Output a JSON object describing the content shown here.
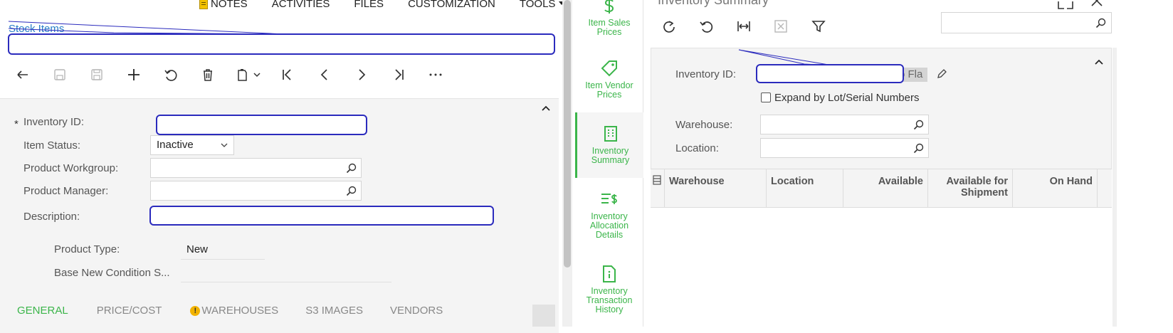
{
  "top_menu": [
    "NOTES",
    "ACTIVITIES",
    "FILES",
    "CUSTOMIZATION",
    "TOOLS"
  ],
  "breadcrumb": "Stock Items",
  "form": {
    "inventory_id_label": "Inventory ID:",
    "required_mark": "*",
    "item_status_label": "Item Status:",
    "item_status_value": "Inactive",
    "product_workgroup_label": "Product Workgroup:",
    "product_manager_label": "Product Manager:",
    "description_label": "Description:",
    "product_type_label": "Product Type:",
    "product_type_value": "New",
    "base_new_condition_label": "Base New Condition S..."
  },
  "tabs": [
    {
      "label": "GENERAL",
      "active": true
    },
    {
      "label": "PRICE/COST",
      "active": false
    },
    {
      "label": "WAREHOUSES",
      "active": false,
      "warning": true
    },
    {
      "label": "S3 IMAGES",
      "active": false
    },
    {
      "label": "VENDORS",
      "active": false
    }
  ],
  "warning_glyph": "!",
  "side_nav": [
    {
      "label_lines": [
        "Item Sales",
        "Prices"
      ],
      "icon": "dollar-icon"
    },
    {
      "label_lines": [
        "Item Vendor",
        "Prices"
      ],
      "icon": "tag-icon"
    },
    {
      "label_lines": [
        "Inventory",
        "Summary"
      ],
      "icon": "building-icon",
      "active": true
    },
    {
      "label_lines": [
        "Inventory",
        "Allocation",
        "Details"
      ],
      "icon": "list-dollar-icon"
    },
    {
      "label_lines": [
        "Inventory",
        "Transaction",
        "History"
      ],
      "icon": "info-doc-icon"
    }
  ],
  "panel": {
    "title": "Inventory Summary",
    "inventory_id_label": "Inventory ID:",
    "inventory_id_fragment": "o Fla",
    "expand_label": "Expand by Lot/Serial Numbers",
    "warehouse_label": "Warehouse:",
    "location_label": "Location:",
    "columns": [
      {
        "label": "Warehouse",
        "align": "left"
      },
      {
        "label": "Location",
        "align": "left"
      },
      {
        "label": "Available",
        "align": "right"
      },
      {
        "label": "Available for Shipment",
        "align": "right"
      },
      {
        "label": "On Hand",
        "align": "right"
      }
    ]
  },
  "colors": {
    "accent_green": "#3bb54a",
    "link_blue": "#2a7fc9",
    "redaction_border": "#2b2bbd",
    "form_bg": "#f4f4f4"
  }
}
